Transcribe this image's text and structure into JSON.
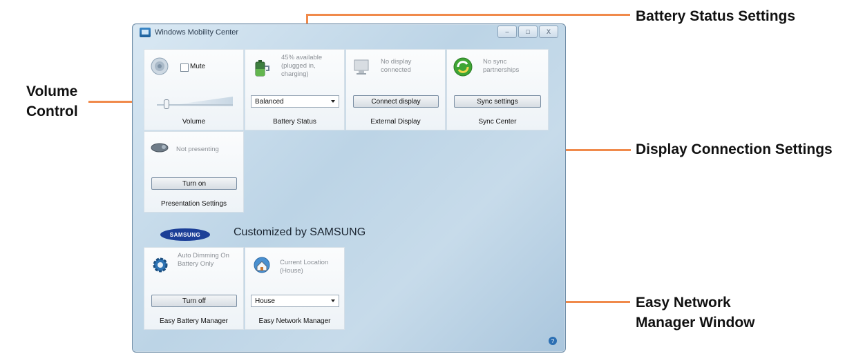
{
  "window": {
    "title": "Windows Mobility Center",
    "controls": [
      "–",
      "□",
      "X"
    ],
    "customized_text": "Customized by SAMSUNG",
    "logo_text": "SAMSUNG"
  },
  "tiles": {
    "volume": {
      "mute_label": "Mute",
      "mute_checked": false,
      "label": "Volume",
      "level": 0.1
    },
    "battery": {
      "status": "45% available (plugged in, charging)",
      "plan": "Balanced",
      "label": "Battery Status"
    },
    "display": {
      "status": "No display connected",
      "button": "Connect display",
      "label": "External Display"
    },
    "sync": {
      "status": "No sync partnerships",
      "button": "Sync settings",
      "label": "Sync Center"
    },
    "presentation": {
      "status": "Not presenting",
      "button": "Turn on",
      "label": "Presentation Settings"
    },
    "easy_battery": {
      "status": "Auto Dimming On Battery Only",
      "button": "Turn off",
      "label": "Easy Battery Manager"
    },
    "easy_network": {
      "status": "Current Location (House)",
      "location": "House",
      "label": "Easy Network Manager"
    }
  },
  "callouts": {
    "volume": "Volume Control",
    "battery": "Battery Status Settings",
    "display": "Display Connection Settings",
    "network": "Easy Network Manager Window"
  },
  "colors": {
    "callout_line": "#f08a4b",
    "window_bg": "#c7dbea",
    "tile_bg": "#f4f7fa"
  }
}
